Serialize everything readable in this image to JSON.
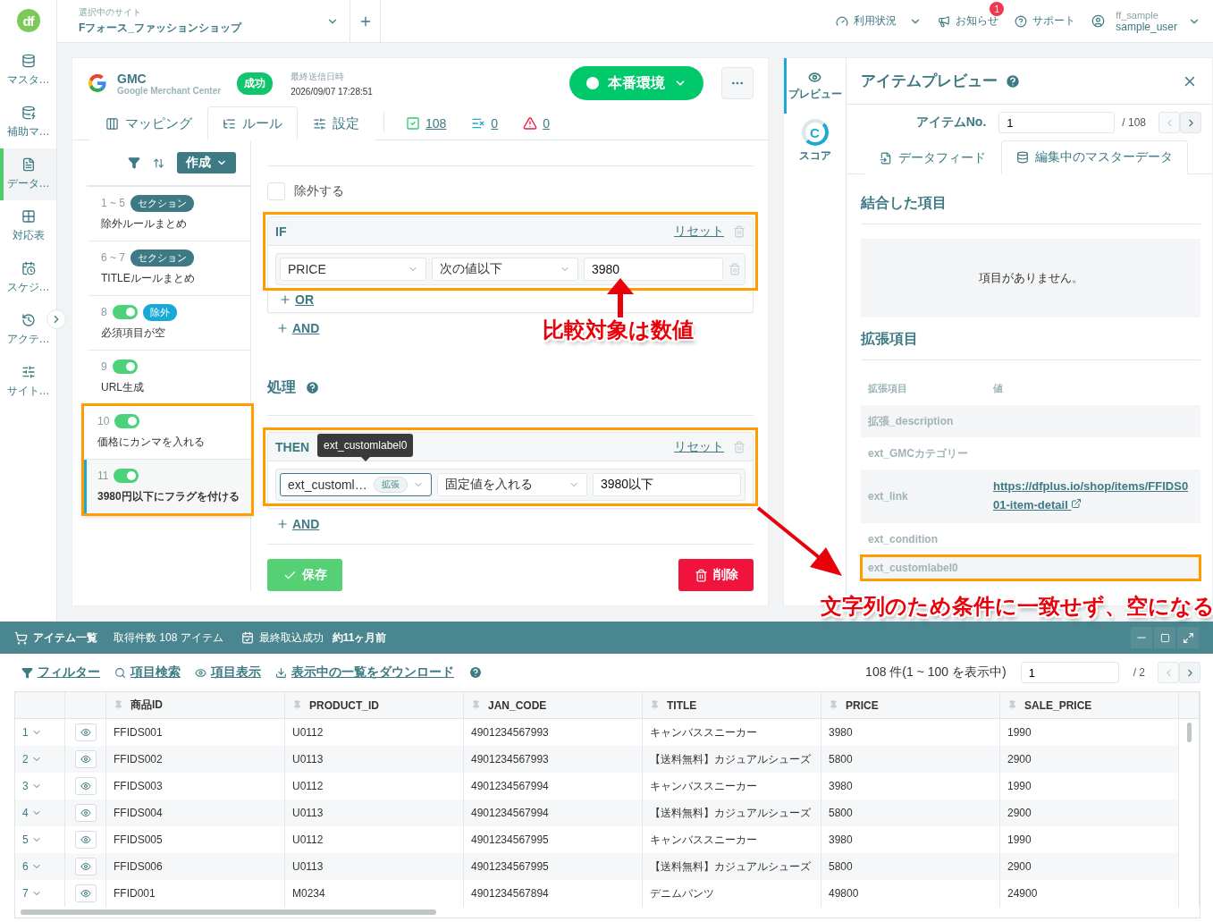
{
  "logo": "df",
  "nav": [
    {
      "label": "マスタ…",
      "selected": false
    },
    {
      "label": "補助マ…",
      "selected": false
    },
    {
      "label": "データ…",
      "selected": true
    },
    {
      "label": "対応表",
      "selected": false
    },
    {
      "label": "スケジ…",
      "selected": false
    },
    {
      "label": "アクテ…",
      "selected": false
    },
    {
      "label": "サイト…",
      "selected": false
    }
  ],
  "site": {
    "label": "選択中のサイト",
    "name": "Fフォース_ファッションショップ"
  },
  "header_menu": [
    {
      "kind": "usage",
      "label": "利用状況"
    },
    {
      "kind": "news",
      "label": "お知らせ",
      "badge": "1"
    },
    {
      "kind": "support",
      "label": "サポート"
    }
  ],
  "user": {
    "org": "ff_sample",
    "name": "sample_user"
  },
  "channel": {
    "name": "GMC",
    "subtitle": "Google Merchant Center",
    "status": "成功",
    "sent_label": "最終送信日時",
    "sent_at": "2026/09/07 17:28:51",
    "env": "本番環境"
  },
  "tabs": [
    {
      "label": "マッピング",
      "selected": false
    },
    {
      "label": "ルール",
      "selected": true
    },
    {
      "label": "設定",
      "selected": false
    }
  ],
  "counts": [
    {
      "kind": "ok",
      "value": "108"
    },
    {
      "kind": "excluded",
      "value": "0"
    },
    {
      "kind": "error",
      "value": "0"
    }
  ],
  "create": "作成",
  "rules": [
    {
      "kind": "section",
      "number": "1 ~ 5",
      "tag": "セクション",
      "name": "除外ルールまとめ",
      "selected": false,
      "highlighted": false
    },
    {
      "kind": "section",
      "number": "6 ~ 7",
      "tag": "セクション",
      "name": "TITLEルールまとめ",
      "selected": false,
      "highlighted": false
    },
    {
      "kind": "rule",
      "number": "8",
      "on": true,
      "tag": "除外",
      "name": "必須項目が空",
      "selected": false,
      "highlighted": false
    },
    {
      "kind": "rule",
      "number": "9",
      "on": true,
      "name": "URL生成",
      "selected": false,
      "highlighted": false
    },
    {
      "kind": "rule",
      "number": "10",
      "on": true,
      "name": "価格にカンマを入れる",
      "selected": false,
      "highlighted": true
    },
    {
      "kind": "rule",
      "number": "11",
      "on": true,
      "name": "3980円以下にフラグを付ける",
      "selected": true,
      "highlighted": true
    }
  ],
  "editor": {
    "exclude": {
      "label": "除外する",
      "checked": false
    },
    "if": {
      "title": "IF",
      "reset": "リセット",
      "highlighted": true,
      "field": "PRICE",
      "operator": "次の値以下",
      "value": "3980",
      "or": "OR"
    },
    "if_and": "AND",
    "process_title": "処理",
    "then": {
      "title": "THEN",
      "reset": "リセット",
      "highlighted": true,
      "field": "ext_customl…",
      "field_tag": "拡張",
      "operator": "固定値を入れる",
      "value": "3980以下",
      "tooltip": "ext_customlabel0"
    },
    "then_and": "AND",
    "save": "保存",
    "delete": "削除"
  },
  "callouts": [
    {
      "text": "比較対象は数値"
    },
    {
      "text": "文字列のため条件に一致せず、空になる"
    }
  ],
  "preview": {
    "side_tabs": [
      {
        "kind": "preview",
        "label": "プレビュー",
        "selected": true
      },
      {
        "kind": "score",
        "label": "スコア",
        "score": "C",
        "selected": false
      }
    ],
    "title": "アイテムプレビュー",
    "item_no_label": "アイテムNo.",
    "item_no": "1",
    "item_total": "/ 108",
    "tabs": [
      {
        "label": "データフィード",
        "selected": false
      },
      {
        "label": "編集中のマスターデータ",
        "selected": true
      }
    ],
    "merged_title": "結合した項目",
    "empty": "項目がありません。",
    "ext_title": "拡張項目",
    "ext_columns": [
      "拡張項目",
      "値"
    ],
    "ext_rows": [
      {
        "name": "拡張_description",
        "highlighted": false
      },
      {
        "name": "ext_GMCカテゴリー",
        "highlighted": false
      },
      {
        "name": "ext_link",
        "value": "https://dfplus.io/shop/items/FFIDS001-item-detail",
        "highlighted": false
      },
      {
        "name": "ext_condition",
        "highlighted": false
      },
      {
        "name": "ext_customlabel0",
        "highlighted": true
      }
    ]
  },
  "items": {
    "title": "アイテム一覧",
    "count": "取得件数 108 アイテム",
    "fetched_label": "最終取込成功",
    "fetched_at": "約11ヶ月前",
    "actions": [
      {
        "kind": "filter",
        "label": "フィルター"
      },
      {
        "kind": "search",
        "label": "項目検索"
      },
      {
        "kind": "view",
        "label": "項目表示"
      },
      {
        "kind": "download",
        "label": "表示中の一覧をダウンロード"
      }
    ],
    "range": "108 件(1 ~ 100 を表示中)",
    "page": "1",
    "pages": "/ 2",
    "columns": [
      "商品ID",
      "PRODUCT_ID",
      "JAN_CODE",
      "TITLE",
      "PRICE",
      "SALE_PRICE"
    ],
    "rows": [
      {
        "index": "1",
        "cells": [
          "FFIDS001",
          "U0112",
          "4901234567993",
          "キャンバススニーカー",
          "3980",
          "1990"
        ]
      },
      {
        "index": "2",
        "cells": [
          "FFIDS002",
          "U0113",
          "4901234567993",
          "【送料無料】カジュアルシューズ",
          "5800",
          "2900"
        ]
      },
      {
        "index": "3",
        "cells": [
          "FFIDS003",
          "U0112",
          "4901234567994",
          "キャンバススニーカー",
          "3980",
          "1990"
        ]
      },
      {
        "index": "4",
        "cells": [
          "FFIDS004",
          "U0113",
          "4901234567994",
          "【送料無料】カジュアルシューズ",
          "5800",
          "2900"
        ]
      },
      {
        "index": "5",
        "cells": [
          "FFIDS005",
          "U0112",
          "4901234567995",
          "キャンバススニーカー",
          "3980",
          "1990"
        ]
      },
      {
        "index": "6",
        "cells": [
          "FFIDS006",
          "U0113",
          "4901234567995",
          "【送料無料】カジュアルシューズ",
          "5800",
          "2900"
        ]
      },
      {
        "index": "7",
        "cells": [
          "FFID001",
          "M0234",
          "4901234567894",
          "デニムパンツ",
          "49800",
          "24900"
        ]
      }
    ]
  }
}
